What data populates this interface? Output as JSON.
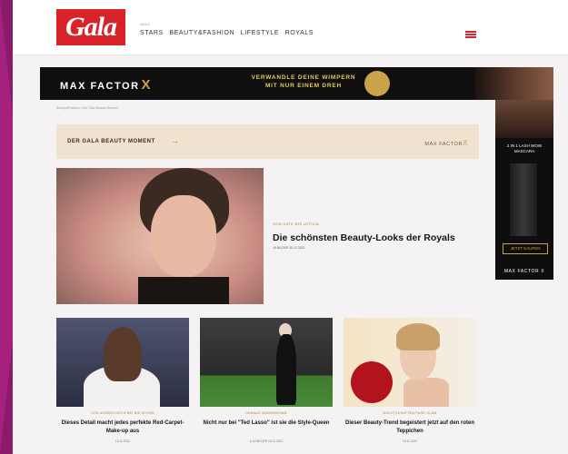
{
  "header": {
    "logo": "Gala",
    "nav_small": "GALA",
    "nav": [
      "STARS",
      "BEAUTY&FASHION",
      "LIFESTYLE",
      "ROYALS"
    ],
    "menu_icon": "hamburger-icon",
    "brand_color": "#d8232a"
  },
  "ad_banner": {
    "brand": "MAX FACTOR",
    "brand_x": "X",
    "tagline_line1": "VERWANDLE DEINE WIMPERN",
    "tagline_line2": "MIT NUR EINEM DREH"
  },
  "skyscraper_ad": {
    "text": "2 IN 1 LASH WOW MASCARA",
    "button": "JETZT KAUFEN",
    "brand": "MAX FACTOR X"
  },
  "breadcrumb": "Beauty&Fashion / Der Gala Beauty Moment",
  "beauty_bar": {
    "title": "DER GALA BEAUTY MOMENT",
    "arrow": "→",
    "brand": "MAX FACTOR",
    "brand_x": "X",
    "bg_color": "#efe3cf"
  },
  "hero": {
    "kicker": "VON KATE BIS LETIZIA",
    "title": "Die schönsten Beauty-Looks der Royals",
    "meta": "16 BILDER   15.11.2021"
  },
  "cards": [
    {
      "kicker": "VON AUSSEN NOCH BEI BIS SCHÖN",
      "title": "Dieses Detail macht jedes perfekte Red-Carpet-Make-up aus",
      "meta": "15.11.2021"
    },
    {
      "kicker": "HANNAH WADDINGHAM",
      "title": "Nicht nur bei \"Ted Lasso\" ist sie die Style-Queen",
      "meta": "● 16 BILDER   15.11.2021"
    },
    {
      "kicker": "NACHTSCHATTEN PAGE GLAM",
      "title": "Dieser Beauty-Trend begeistert jetzt auf den roten Teppichen",
      "meta": "15.11.2021"
    }
  ]
}
